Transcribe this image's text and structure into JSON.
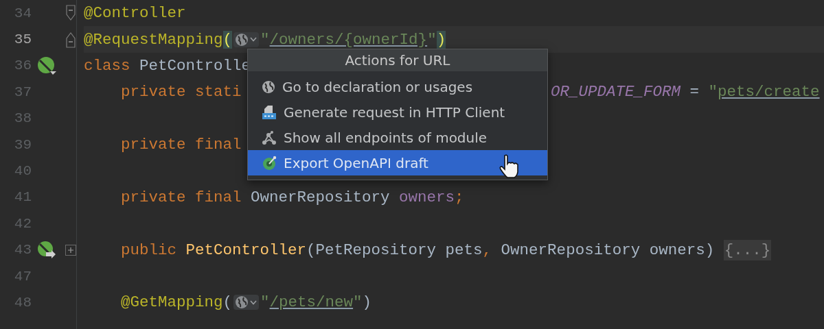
{
  "editor": {
    "lines": [
      {
        "number": "34",
        "current": false,
        "indented": false,
        "fold_start": true,
        "tokens": [
          {
            "kind": "annotation",
            "text": "@Controller"
          }
        ]
      },
      {
        "number": "35",
        "current": true,
        "indented": false,
        "fold_end": true,
        "tokens": [
          {
            "kind": "annotation",
            "text": "@RequestMapping"
          },
          {
            "kind": "paren-match",
            "text": "("
          },
          {
            "kind": "url-chip"
          },
          {
            "kind": "string",
            "text": "\""
          },
          {
            "kind": "link",
            "text": "/owners/{ownerId}"
          },
          {
            "kind": "string",
            "text": "\""
          },
          {
            "kind": "paren-match",
            "text": ")"
          }
        ]
      },
      {
        "number": "36",
        "current": false,
        "indented": false,
        "bean_marker": true,
        "tokens": [
          {
            "kind": "keyword",
            "text": "class"
          },
          {
            "kind": "plain",
            "text": " PetControlle"
          }
        ]
      },
      {
        "number": "37",
        "current": false,
        "indented": true,
        "tokens": [
          {
            "kind": "keyword",
            "text": "private stati"
          }
        ],
        "resumed": [
          {
            "kind": "constant",
            "text": "OR_UPDATE_FORM"
          },
          {
            "kind": "plain",
            "text": " = "
          },
          {
            "kind": "string",
            "text": "\""
          },
          {
            "kind": "link",
            "text": "pets/create"
          }
        ]
      },
      {
        "number": "38",
        "current": false
      },
      {
        "number": "39",
        "current": false,
        "indented": true,
        "tokens": [
          {
            "kind": "keyword",
            "text": "private final"
          }
        ]
      },
      {
        "number": "40",
        "current": false
      },
      {
        "number": "41",
        "current": false,
        "indented": true,
        "tokens": [
          {
            "kind": "keyword",
            "text": "private final "
          },
          {
            "kind": "plain",
            "text": "OwnerRepository "
          },
          {
            "kind": "field",
            "text": "owners"
          },
          {
            "kind": "punct",
            "text": ";"
          }
        ]
      },
      {
        "number": "42",
        "current": false
      },
      {
        "number": "43",
        "current": false,
        "indented": true,
        "bean_arrow_marker": true,
        "collapsed": true,
        "tokens": [
          {
            "kind": "keyword",
            "text": "public "
          },
          {
            "kind": "method",
            "text": "PetController"
          },
          {
            "kind": "plain",
            "text": "(PetRepository pets"
          },
          {
            "kind": "punct",
            "text": ","
          },
          {
            "kind": "plain",
            "text": " OwnerRepository owners) "
          },
          {
            "kind": "folded",
            "text": "{...}"
          }
        ]
      },
      {
        "number": "47",
        "current": false
      },
      {
        "number": "48",
        "current": false,
        "indented": true,
        "tokens": [
          {
            "kind": "annotation",
            "text": "@GetMapping"
          },
          {
            "kind": "plain",
            "text": "("
          },
          {
            "kind": "url-chip"
          },
          {
            "kind": "string",
            "text": "\""
          },
          {
            "kind": "link",
            "text": "/pets/new"
          },
          {
            "kind": "string",
            "text": "\""
          },
          {
            "kind": "plain",
            "text": ")"
          }
        ]
      }
    ]
  },
  "popup": {
    "title": "Actions for URL",
    "items": [
      {
        "kind": "globe",
        "label": "Go to declaration or usages",
        "selected": false
      },
      {
        "kind": "api",
        "label": "Generate request in HTTP Client",
        "selected": false
      },
      {
        "kind": "endpoints",
        "label": "Show all endpoints of module",
        "selected": false
      },
      {
        "kind": "openapi",
        "label": "Export OpenAPI draft",
        "selected": true
      }
    ]
  }
}
